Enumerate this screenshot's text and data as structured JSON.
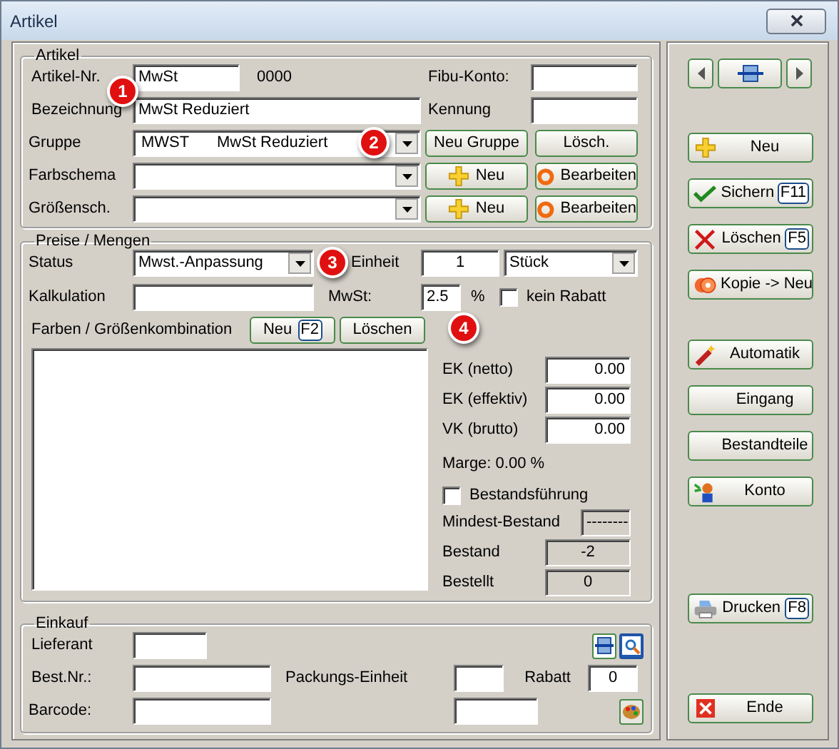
{
  "window": {
    "title": "Artikel"
  },
  "artikel": {
    "title": "Artikel",
    "artikel_nr": {
      "label": "Artikel-Nr.",
      "value": "MwSt",
      "callout": "1"
    },
    "number": "0000",
    "fibu_konto": {
      "label": "Fibu-Konto:"
    },
    "bezeichnung": {
      "label": "Bezeichnung",
      "value": "MwSt Reduziert"
    },
    "kennung": {
      "label": "Kennung"
    },
    "combo_rows": [
      {
        "label": "Gruppe",
        "code": "MWST",
        "value": "MwSt Reduziert",
        "callout": "2",
        "buttons": [
          {
            "label": "Neu Gruppe",
            "kind": "plain"
          },
          {
            "label": "Lösch.",
            "kind": "plain"
          }
        ]
      },
      {
        "label": "Farbschema",
        "buttons": [
          {
            "label": "Neu",
            "kind": "plus"
          },
          {
            "label": "Bearbeiten",
            "kind": "ring"
          }
        ]
      },
      {
        "label": "Größensch.",
        "buttons": [
          {
            "label": "Neu",
            "kind": "plus"
          },
          {
            "label": "Bearbeiten",
            "kind": "ring"
          }
        ]
      }
    ]
  },
  "preise": {
    "title": "Preise / Mengen",
    "status": {
      "label": "Status",
      "value": "Mwst.-Anpassung",
      "callout": "3"
    },
    "einheit": {
      "label": "Einheit",
      "value": "1",
      "unit": "Stück"
    },
    "kalkulation": {
      "label": "Kalkulation"
    },
    "mwst": {
      "label": "MwSt:",
      "value": "2.5",
      "suffix": "%",
      "callout": "4"
    },
    "kein_rabatt": {
      "label": "kein Rabatt",
      "checked": false
    },
    "kombination": {
      "label": "Farben / Größenkombination",
      "buttons": [
        {
          "label": "Neu",
          "shortcut": "F2"
        },
        {
          "label": "Löschen"
        }
      ]
    },
    "prices": [
      {
        "label": "EK (netto)",
        "value": "0.00",
        "disabled": false
      },
      {
        "label": "EK (effektiv)",
        "value": "0.00",
        "disabled": false
      },
      {
        "label": "VK (brutto)",
        "value": "0.00",
        "disabled": false
      }
    ],
    "marge": "Marge: 0.00 %",
    "bestandsfuehrung": {
      "label": "Bestandsführung",
      "checked": false
    },
    "stock": [
      {
        "label": "Mindest-Bestand",
        "value": "--------",
        "disabled": true
      },
      {
        "label": "Bestand",
        "value": "-2",
        "disabled": true
      },
      {
        "label": "Bestellt",
        "value": "0",
        "disabled": true
      }
    ]
  },
  "einkauf": {
    "title": "Einkauf",
    "lieferant": {
      "label": "Lieferant"
    },
    "best_nr": {
      "label": "Best.Nr.:"
    },
    "packungs_einheit": {
      "label": "Packungs-Einheit"
    },
    "rabatt": {
      "label": "Rabatt",
      "value": "0"
    },
    "barcode": {
      "label": "Barcode:"
    }
  },
  "sidebar": {
    "button_groups": [
      [
        {
          "label": "Neu",
          "kind": "plus"
        },
        {
          "label": "Sichern",
          "shortcut": "F11",
          "kind": "check"
        },
        {
          "label": "Löschen",
          "shortcut": "F5",
          "kind": "cross"
        },
        {
          "label": "Kopie -> Neu",
          "kind": "copy"
        }
      ],
      [
        {
          "label": "Automatik",
          "kind": "wand"
        },
        {
          "label": "Eingang",
          "kind": "plain"
        },
        {
          "label": "Bestandteile",
          "kind": "plain"
        },
        {
          "label": "Konto",
          "kind": "people"
        }
      ],
      [
        {
          "label": "Drucken",
          "shortcut": "F8",
          "kind": "printer"
        }
      ],
      [
        {
          "label": "Ende",
          "kind": "close"
        }
      ]
    ]
  }
}
